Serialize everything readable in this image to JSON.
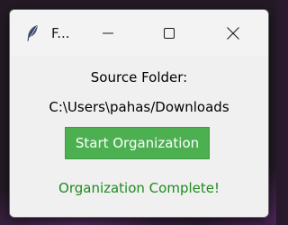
{
  "window": {
    "title": "F..."
  },
  "titlebar": {
    "icons": {
      "app": "feather-icon",
      "minimize": "minimize-icon",
      "maximize": "maximize-icon",
      "close": "close-icon"
    }
  },
  "main": {
    "source_label": "Source Folder:",
    "source_path": "C:\\Users\\pahas/Downloads",
    "start_button_label": "Start Organization",
    "status_text": "Organization Complete!"
  },
  "colors": {
    "button_bg": "#4caf50",
    "button_text": "#ffffff",
    "status_text": "#1f8a1f",
    "window_bg": "#f0f0f0"
  }
}
